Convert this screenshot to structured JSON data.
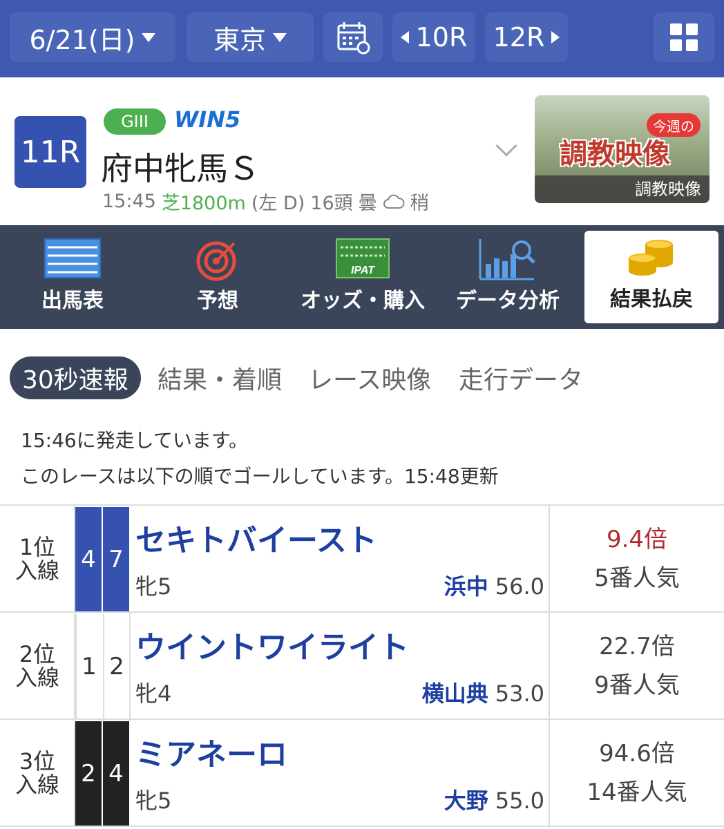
{
  "topbar": {
    "date": "6/21(日)",
    "venue": "東京",
    "prev_race": "10R",
    "next_race": "12R"
  },
  "race": {
    "number": "11R",
    "grade": "GIII",
    "win5": "WIN5",
    "name": "府中牝馬Ｓ",
    "time": "15:45",
    "surface": "芝1800m",
    "direction": "(左 D)",
    "runners": "16頭",
    "weather": "曇",
    "going": "稍"
  },
  "training_video": {
    "title": "調教映像",
    "badge": "今週の",
    "label": "調教映像"
  },
  "nav": [
    {
      "label": "出馬表",
      "icon": "entry-table-icon"
    },
    {
      "label": "予想",
      "icon": "target-icon"
    },
    {
      "label": "オッズ・購入",
      "icon": "ipat-icon"
    },
    {
      "label": "データ分析",
      "icon": "chart-search-icon"
    },
    {
      "label": "結果払戻",
      "icon": "coins-icon"
    }
  ],
  "subtabs": [
    "30秒速報",
    "結果・着順",
    "レース映像",
    "走行データ"
  ],
  "notice": {
    "line1": "15:46に発走しています。",
    "line2": "このレースは以下の順でゴールしています。15:48更新"
  },
  "results": [
    {
      "pos": "1位",
      "label": "入線",
      "frame": "4",
      "num": "7",
      "horse": "セキトバイースト",
      "sex": "牝5",
      "jockey": "浜中",
      "weight": "56.0",
      "odds": "9.4倍",
      "pop": "5番人気",
      "frame_color": "#3652b0",
      "odds_color": "#b3282d"
    },
    {
      "pos": "2位",
      "label": "入線",
      "frame": "1",
      "num": "2",
      "horse": "ウイントワイライト",
      "sex": "牝4",
      "jockey": "横山典",
      "weight": "53.0",
      "odds": "22.7倍",
      "pop": "9番人気",
      "frame_color": "#ffffff",
      "odds_color": "#444444"
    },
    {
      "pos": "3位",
      "label": "入線",
      "frame": "2",
      "num": "4",
      "horse": "ミアネーロ",
      "sex": "牝5",
      "jockey": "大野",
      "weight": "55.0",
      "odds": "94.6倍",
      "pop": "14番人気",
      "frame_color": "#222222",
      "odds_color": "#444444"
    }
  ],
  "colors": {
    "topbar": "#3e59ad",
    "nav": "#3b4559",
    "race_badge": "#3652b0",
    "grade": "#4caf50"
  }
}
